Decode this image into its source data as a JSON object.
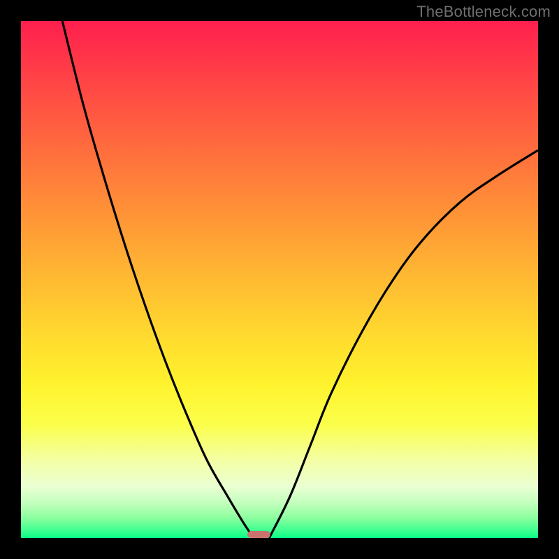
{
  "watermark": "TheBottleneck.com",
  "chart_data": {
    "type": "line",
    "title": "",
    "xlabel": "",
    "ylabel": "",
    "xlim": [
      0,
      100
    ],
    "ylim": [
      0,
      100
    ],
    "grid": false,
    "legend": false,
    "background_gradient": {
      "top": "#ff1f4e",
      "mid": "#ffe32d",
      "bottom": "#06ff87"
    },
    "series": [
      {
        "name": "left-curve",
        "x": [
          8,
          12,
          16,
          20,
          24,
          28,
          32,
          36,
          40,
          43,
          45
        ],
        "values": [
          100,
          84,
          70,
          57,
          45,
          34,
          24,
          15,
          8,
          3,
          0
        ]
      },
      {
        "name": "right-curve",
        "x": [
          48,
          52,
          56,
          60,
          66,
          72,
          78,
          85,
          92,
          100
        ],
        "values": [
          0,
          8,
          18,
          28,
          40,
          50,
          58,
          65,
          70,
          75
        ]
      }
    ],
    "marker": {
      "name": "bottleneck-marker",
      "x": 46,
      "y": 0,
      "width_frac": 0.045,
      "height_frac": 0.013,
      "color": "#c9736f"
    }
  }
}
